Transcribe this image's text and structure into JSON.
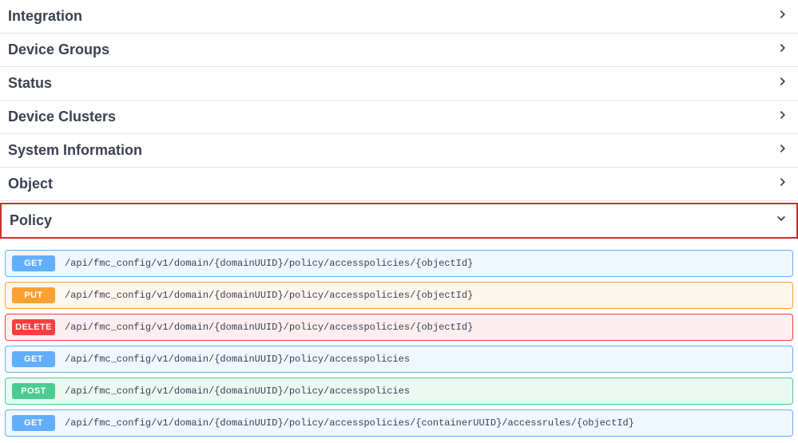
{
  "sections": [
    {
      "label": "Integration",
      "expanded": false,
      "highlight": false
    },
    {
      "label": "Device Groups",
      "expanded": false,
      "highlight": false
    },
    {
      "label": "Status",
      "expanded": false,
      "highlight": false
    },
    {
      "label": "Device Clusters",
      "expanded": false,
      "highlight": false
    },
    {
      "label": "System Information",
      "expanded": false,
      "highlight": false
    },
    {
      "label": "Object",
      "expanded": false,
      "highlight": false
    },
    {
      "label": "Policy",
      "expanded": true,
      "highlight": true
    }
  ],
  "endpoints": [
    {
      "method": "GET",
      "path": "/api/fmc_config/v1/domain/{domainUUID}/policy/accesspolicies/{objectId}"
    },
    {
      "method": "PUT",
      "path": "/api/fmc_config/v1/domain/{domainUUID}/policy/accesspolicies/{objectId}"
    },
    {
      "method": "DELETE",
      "path": "/api/fmc_config/v1/domain/{domainUUID}/policy/accesspolicies/{objectId}"
    },
    {
      "method": "GET",
      "path": "/api/fmc_config/v1/domain/{domainUUID}/policy/accesspolicies"
    },
    {
      "method": "POST",
      "path": "/api/fmc_config/v1/domain/{domainUUID}/policy/accesspolicies"
    },
    {
      "method": "GET",
      "path": "/api/fmc_config/v1/domain/{domainUUID}/policy/accesspolicies/{containerUUID}/accessrules/{objectId}"
    }
  ]
}
